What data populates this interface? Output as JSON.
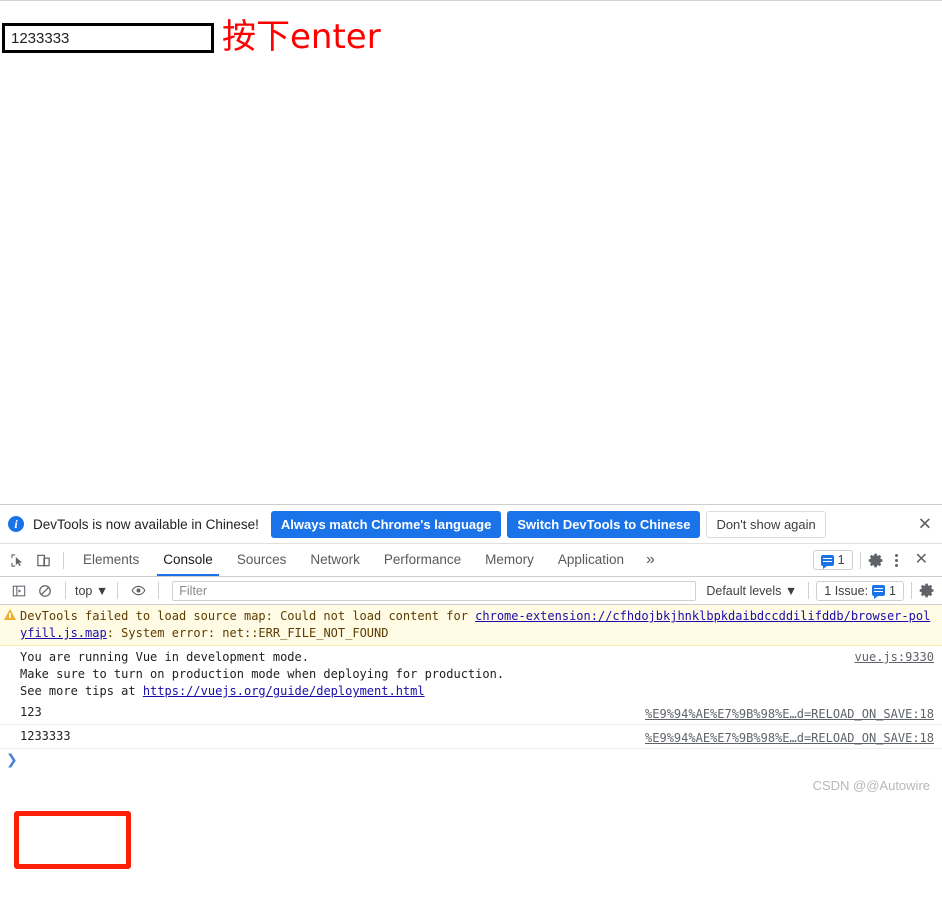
{
  "page": {
    "input_value": "1233333",
    "input_placeholder": "",
    "annotation": "按下enter"
  },
  "devtools": {
    "notification": {
      "icon": "info-icon",
      "message": "DevTools is now available in Chinese!",
      "buttons": [
        {
          "label": "Always match Chrome's language",
          "style": "primary"
        },
        {
          "label": "Switch DevTools to Chinese",
          "style": "primary"
        },
        {
          "label": "Don't show again",
          "style": "secondary"
        }
      ],
      "close": "✕"
    },
    "tabs": [
      {
        "label": "Elements",
        "active": false
      },
      {
        "label": "Console",
        "active": true
      },
      {
        "label": "Sources",
        "active": false
      },
      {
        "label": "Network",
        "active": false
      },
      {
        "label": "Performance",
        "active": false
      },
      {
        "label": "Memory",
        "active": false
      },
      {
        "label": "Application",
        "active": false
      }
    ],
    "tab_overflow": "»",
    "tab_issue_count": "1",
    "toolbar": {
      "context": "top",
      "context_caret": "▼",
      "filter_placeholder": "Filter",
      "filter_value": "",
      "levels": "Default levels",
      "levels_caret": "▼",
      "issues_label": "1 Issue:",
      "issues_count": "1"
    },
    "console": {
      "warning": {
        "text_1": "DevTools failed to load source map: Could not load content for ",
        "link_1": "chrome-extension://cfhdojbkjhnklbpkdaibdccddilifddb/browser-polyfill.js.map",
        "text_2": ": System error: net::ERR_FILE_NOT_FOUND"
      },
      "vue_message": {
        "line_1": "You are running Vue in development mode.",
        "line_2": "Make sure to turn on production mode when deploying for production.",
        "line_3_pre": "See more tips",
        "line_3_mid": " at ",
        "line_3_link": "https://vuejs.org/guide/deployment.html",
        "source": "vue.js:9330"
      },
      "values": [
        {
          "text": "123",
          "source": "%E9%94%AE%E7%9B%98%E…d=RELOAD_ON_SAVE:18"
        },
        {
          "text": "1233333",
          "source": "%E9%94%AE%E7%9B%98%E…d=RELOAD_ON_SAVE:18"
        }
      ],
      "prompt": "❯"
    }
  },
  "watermark": "CSDN @@Autowire",
  "colors": {
    "accent": "#1a73e8",
    "annotation_red": "#fa1f07",
    "warning_bg": "#fffbe5",
    "warning_icon": "#f0ad2e",
    "link": "#1a0dab"
  }
}
